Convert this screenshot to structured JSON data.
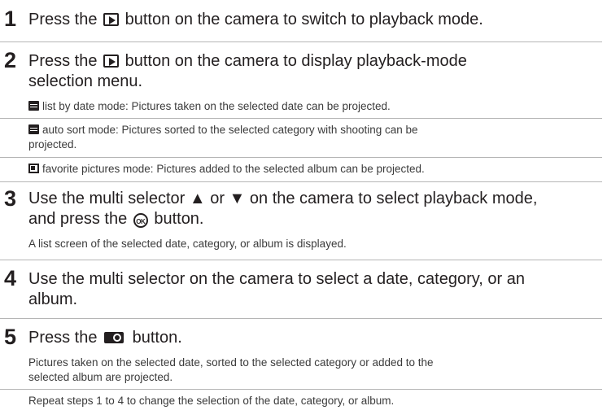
{
  "steps": [
    {
      "number": "1",
      "title_before": "Press the",
      "title_after": "button on the camera to switch to playback mode."
    },
    {
      "number": "2",
      "title_before": "Press the",
      "title_after": "button on the camera to display playback-mode",
      "title_line2": "selection menu.",
      "notes": [
        "list by date mode: Pictures taken on the selected date can be projected.",
        "auto sort mode: Pictures sorted to the selected category with shooting can be",
        "projected.",
        "favorite pictures mode: Pictures added to the selected album can be projected."
      ]
    },
    {
      "number": "3",
      "title_line1": "Use the multi selector ▲ or ▼ on the camera to select playback mode,",
      "title_line2_before": "and press the",
      "title_line2_after": "button.",
      "ok_label": "OK",
      "note": "A list screen of the selected date, category, or album is displayed."
    },
    {
      "number": "4",
      "title_line1": "Use the multi selector on the camera to select a date, category, or an",
      "title_line2": "album."
    },
    {
      "number": "5",
      "title_before": "Press the",
      "title_after": "button.",
      "notes": [
        "Pictures taken on the selected date, sorted to the selected category or added to the",
        "selected album are projected.",
        "Repeat steps 1 to 4 to change the selection of the date, category, or album."
      ]
    }
  ],
  "icons": {
    "play_button": "playback-button-icon",
    "ok_button": "ok-button-icon",
    "projector_button": "projector-button-icon",
    "list_by_date": "list-by-date-icon",
    "auto_sort": "auto-sort-icon",
    "favorites": "favorite-pictures-icon"
  }
}
